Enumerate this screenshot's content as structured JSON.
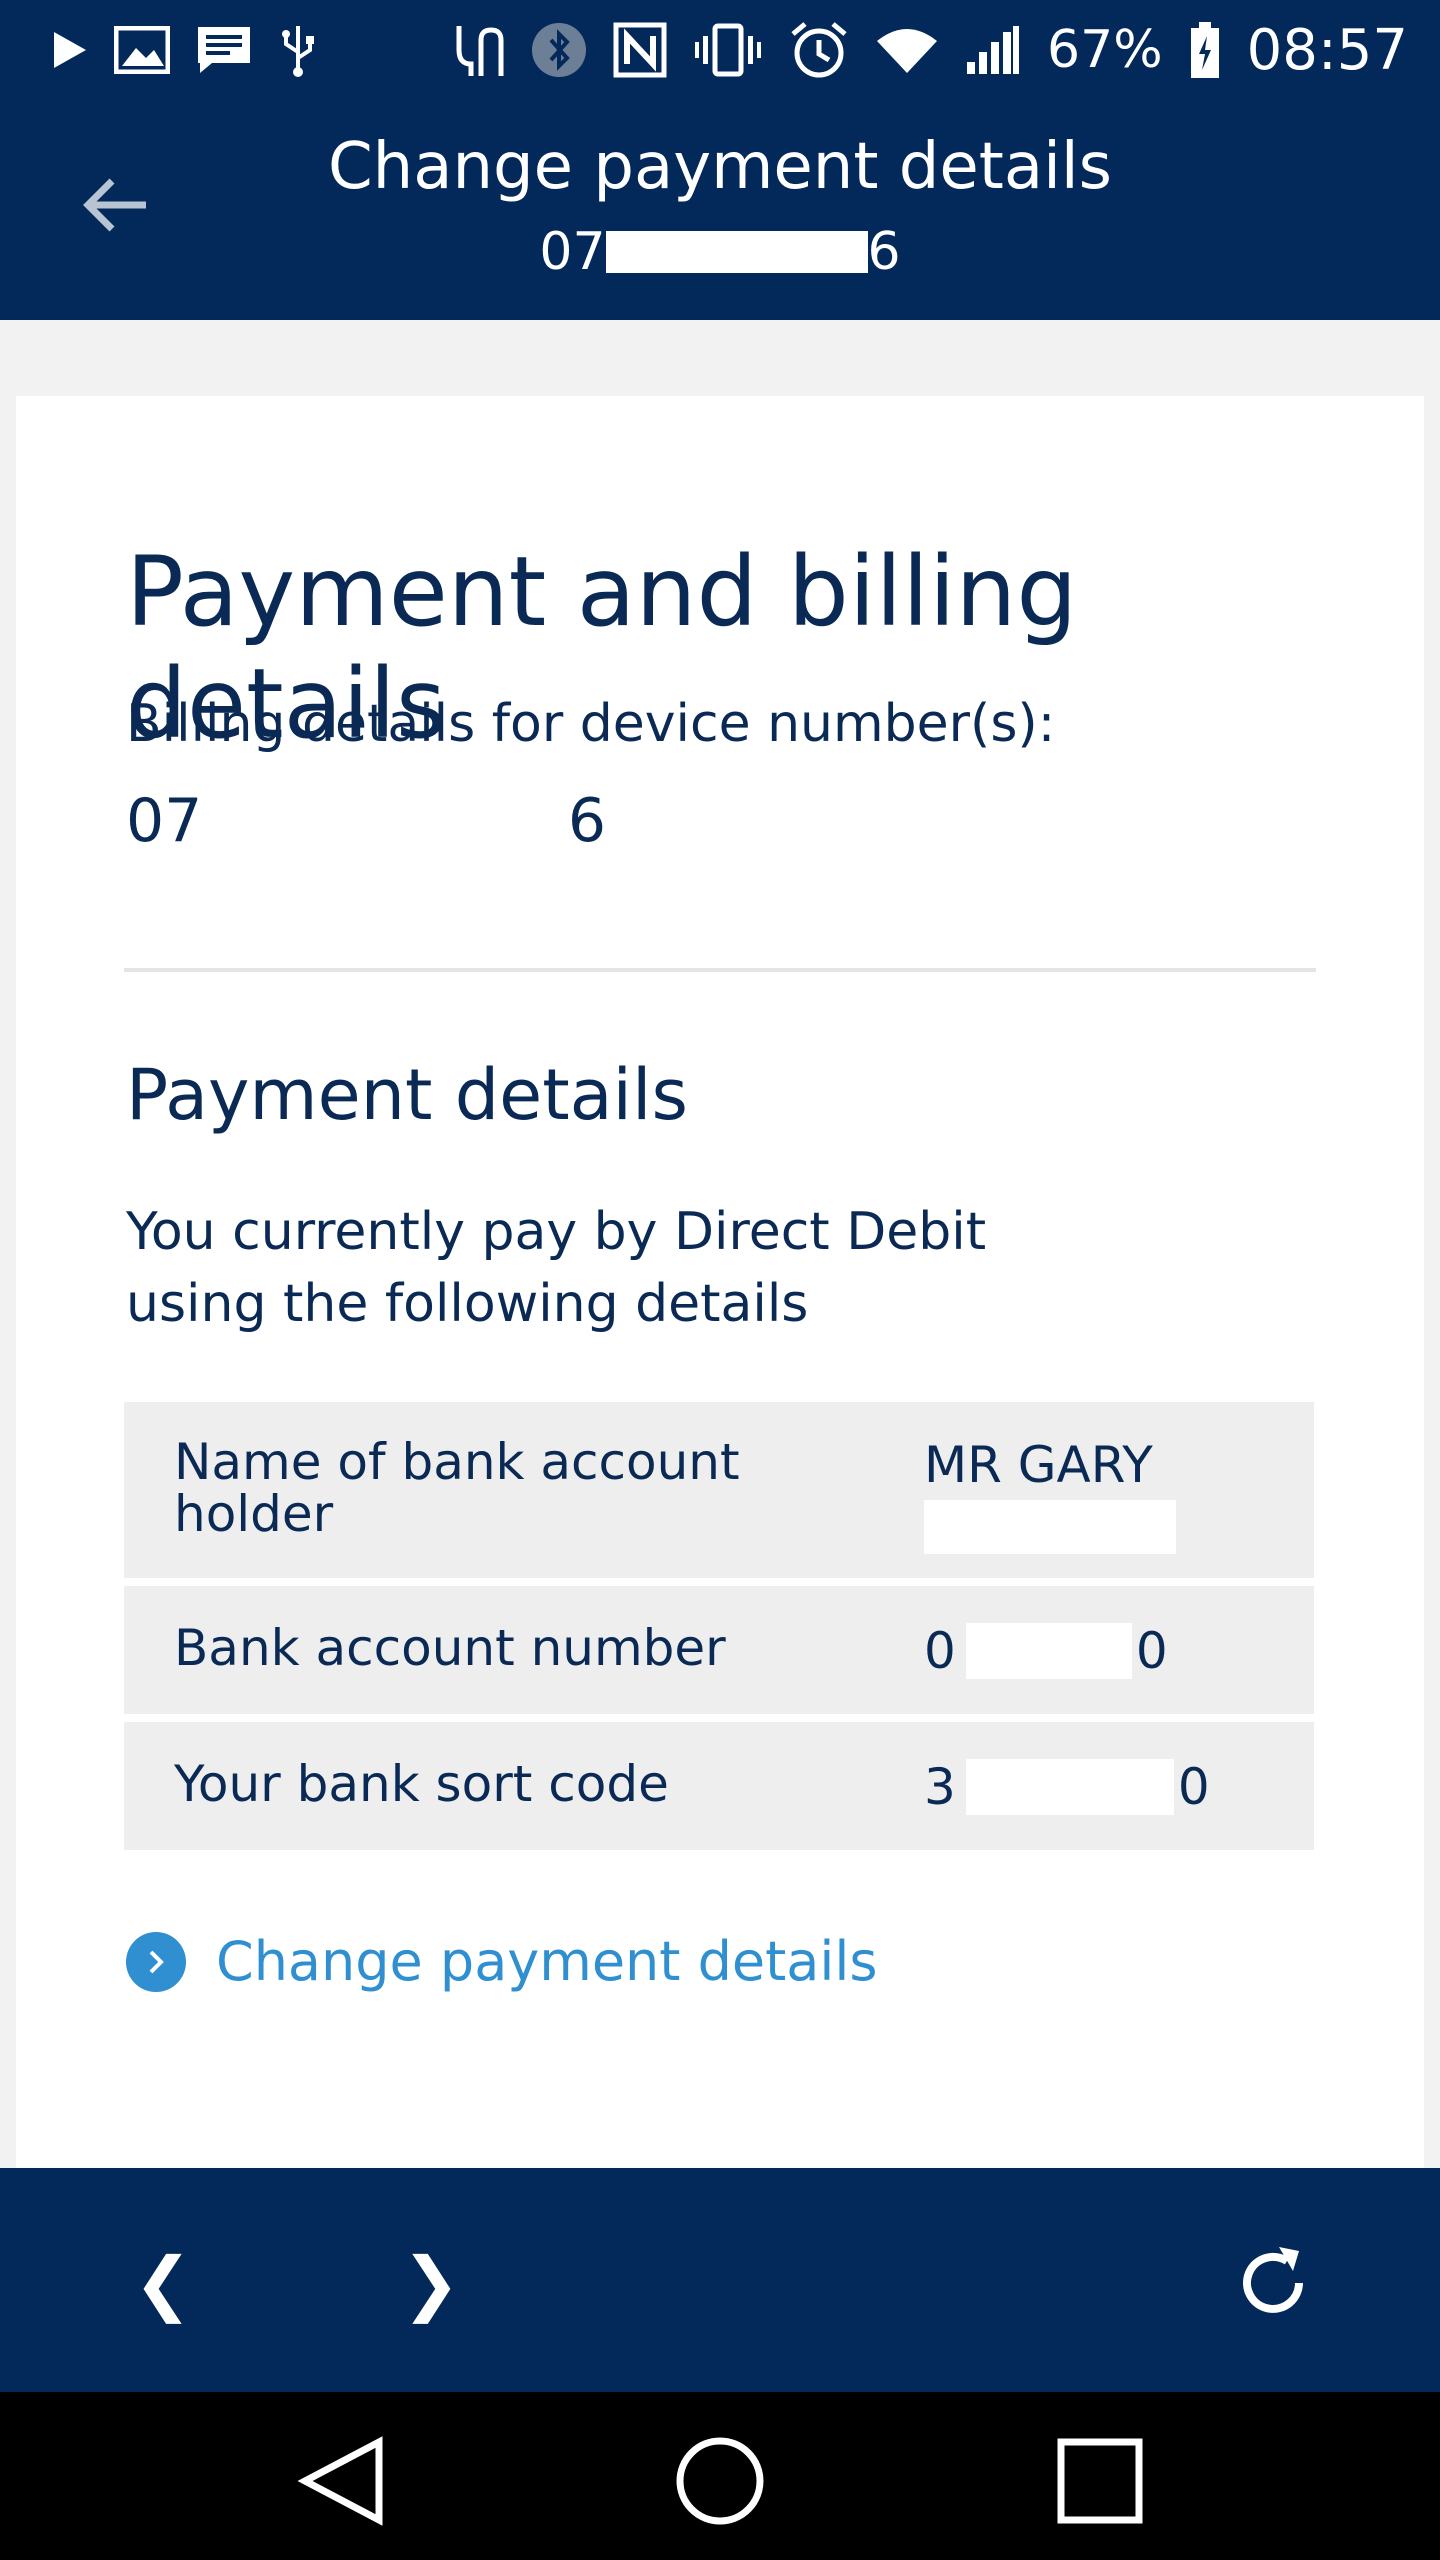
{
  "status_bar": {
    "battery_percent": "67%",
    "time": "08:57",
    "left_icons": [
      "play-icon",
      "image-icon",
      "message-icon",
      "usb-icon"
    ],
    "right_icons": [
      "usb-debug-icon",
      "bluetooth-icon",
      "nfc-icon",
      "vibrate-icon",
      "alarm-icon",
      "wifi-icon",
      "signal-icon",
      "battery-icon"
    ]
  },
  "app_bar": {
    "title": "Change payment details",
    "subtitle_start": "07",
    "subtitle_end": "6"
  },
  "card": {
    "heading": "Payment and billing details",
    "billing_label": "Billing details for device number(s):",
    "device_start": "07",
    "device_end": "6",
    "payment_heading": "Payment details",
    "description": "You currently pay by Direct Debit using the following details",
    "rows": [
      {
        "label": "Name of bank account holder",
        "value": "MR GARY"
      },
      {
        "label": "Bank account number",
        "value_start": "0",
        "value_end": "0"
      },
      {
        "label": "Your bank sort code",
        "value_start": "3",
        "value_end": "0"
      }
    ],
    "change_link": "Change payment details"
  },
  "browser_bar": {
    "back_glyph": "❮",
    "forward_glyph": "❯"
  },
  "colors": {
    "navy": "#03295a",
    "text": "#0a2a55",
    "link": "#2f8fd1",
    "row_bg": "#eeeeee"
  }
}
